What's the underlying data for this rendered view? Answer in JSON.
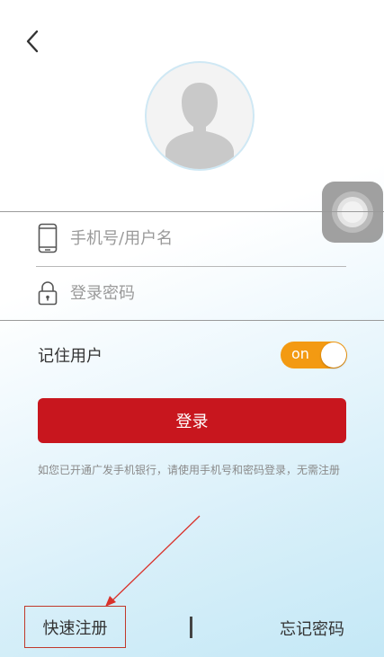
{
  "header": {
    "back_icon": "chevron-left-icon"
  },
  "avatar": {
    "icon": "user-silhouette-icon"
  },
  "assistive_touch": {
    "icon": "assistive-touch-icon"
  },
  "form": {
    "phone": {
      "icon": "phone-icon",
      "placeholder": "手机号/用户名",
      "value": ""
    },
    "password": {
      "icon": "lock-icon",
      "placeholder": "登录密码",
      "value": ""
    }
  },
  "remember": {
    "label": "记住用户",
    "toggle_text": "on",
    "toggle_on": true
  },
  "login_button": {
    "label": "登录"
  },
  "hint": {
    "text": "如您已开通广发手机银行，请使用手机号和密码登录，无需注册"
  },
  "footer": {
    "quick_register": "快速注册",
    "forgot_password": "忘记密码"
  },
  "colors": {
    "primary_red": "#c8161e",
    "toggle_orange": "#f39a12",
    "annotation_red": "#d9322b"
  }
}
